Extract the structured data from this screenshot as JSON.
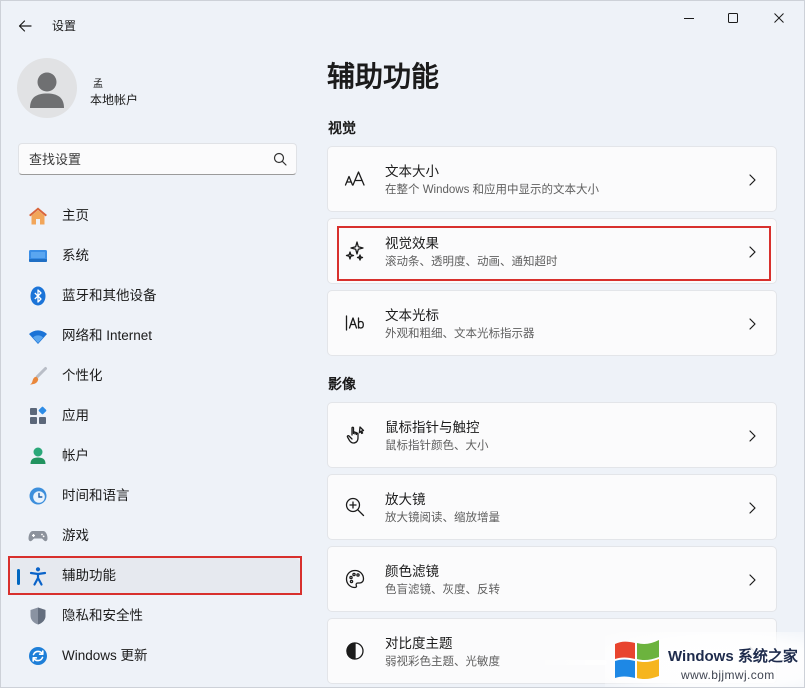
{
  "window": {
    "title": "设置",
    "controls": {
      "back_icon": "back-arrow-icon",
      "minimize_icon": "minimize-icon",
      "maximize_icon": "maximize-icon",
      "close_icon": "close-icon"
    }
  },
  "account": {
    "name": "孟",
    "type": "本地帐户",
    "avatar_icon": "person-icon"
  },
  "search": {
    "placeholder": "查找设置",
    "icon": "search-icon"
  },
  "nav": {
    "items": [
      {
        "label": "主页",
        "icon": "home-icon"
      },
      {
        "label": "系统",
        "icon": "system-icon"
      },
      {
        "label": "蓝牙和其他设备",
        "icon": "bluetooth-icon"
      },
      {
        "label": "网络和 Internet",
        "icon": "wifi-icon"
      },
      {
        "label": "个性化",
        "icon": "brush-icon"
      },
      {
        "label": "应用",
        "icon": "apps-icon"
      },
      {
        "label": "帐户",
        "icon": "account-icon"
      },
      {
        "label": "时间和语言",
        "icon": "time-language-icon"
      },
      {
        "label": "游戏",
        "icon": "gaming-icon"
      },
      {
        "label": "辅助功能",
        "icon": "accessibility-icon",
        "active": true,
        "highlighted": true
      },
      {
        "label": "隐私和安全性",
        "icon": "shield-icon"
      },
      {
        "label": "Windows 更新",
        "icon": "windows-update-icon"
      }
    ]
  },
  "main": {
    "title": "辅助功能",
    "sections": [
      {
        "heading": "视觉",
        "items": [
          {
            "title": "文本大小",
            "subtitle": "在整个 Windows 和应用中显示的文本大小",
            "icon": "text-size-icon"
          },
          {
            "title": "视觉效果",
            "subtitle": "滚动条、透明度、动画、通知超时",
            "icon": "visual-effects-icon",
            "highlighted": true
          },
          {
            "title": "文本光标",
            "subtitle": "外观和粗细、文本光标指示器",
            "icon": "text-cursor-icon"
          }
        ]
      },
      {
        "heading": "影像",
        "items": [
          {
            "title": "鼠标指针与触控",
            "subtitle": "鼠标指针颜色、大小",
            "icon": "mouse-pointer-icon"
          },
          {
            "title": "放大镜",
            "subtitle": "放大镜阅读、缩放增量",
            "icon": "magnifier-icon"
          },
          {
            "title": "颜色滤镜",
            "subtitle": "色盲滤镜、灰度、反转",
            "icon": "color-filter-icon"
          },
          {
            "title": "对比度主题",
            "subtitle": "弱视彩色主题、光敏度",
            "icon": "contrast-icon"
          }
        ]
      }
    ]
  },
  "watermark": {
    "brand": "Windows 系统之家",
    "url": "www.bjjmwj.com",
    "logo_icon": "windows-logo-icon"
  },
  "colors": {
    "background": "#eef2f8",
    "accent": "#0067c0",
    "highlight": "#d8302d",
    "card": "#fbfbfc"
  }
}
